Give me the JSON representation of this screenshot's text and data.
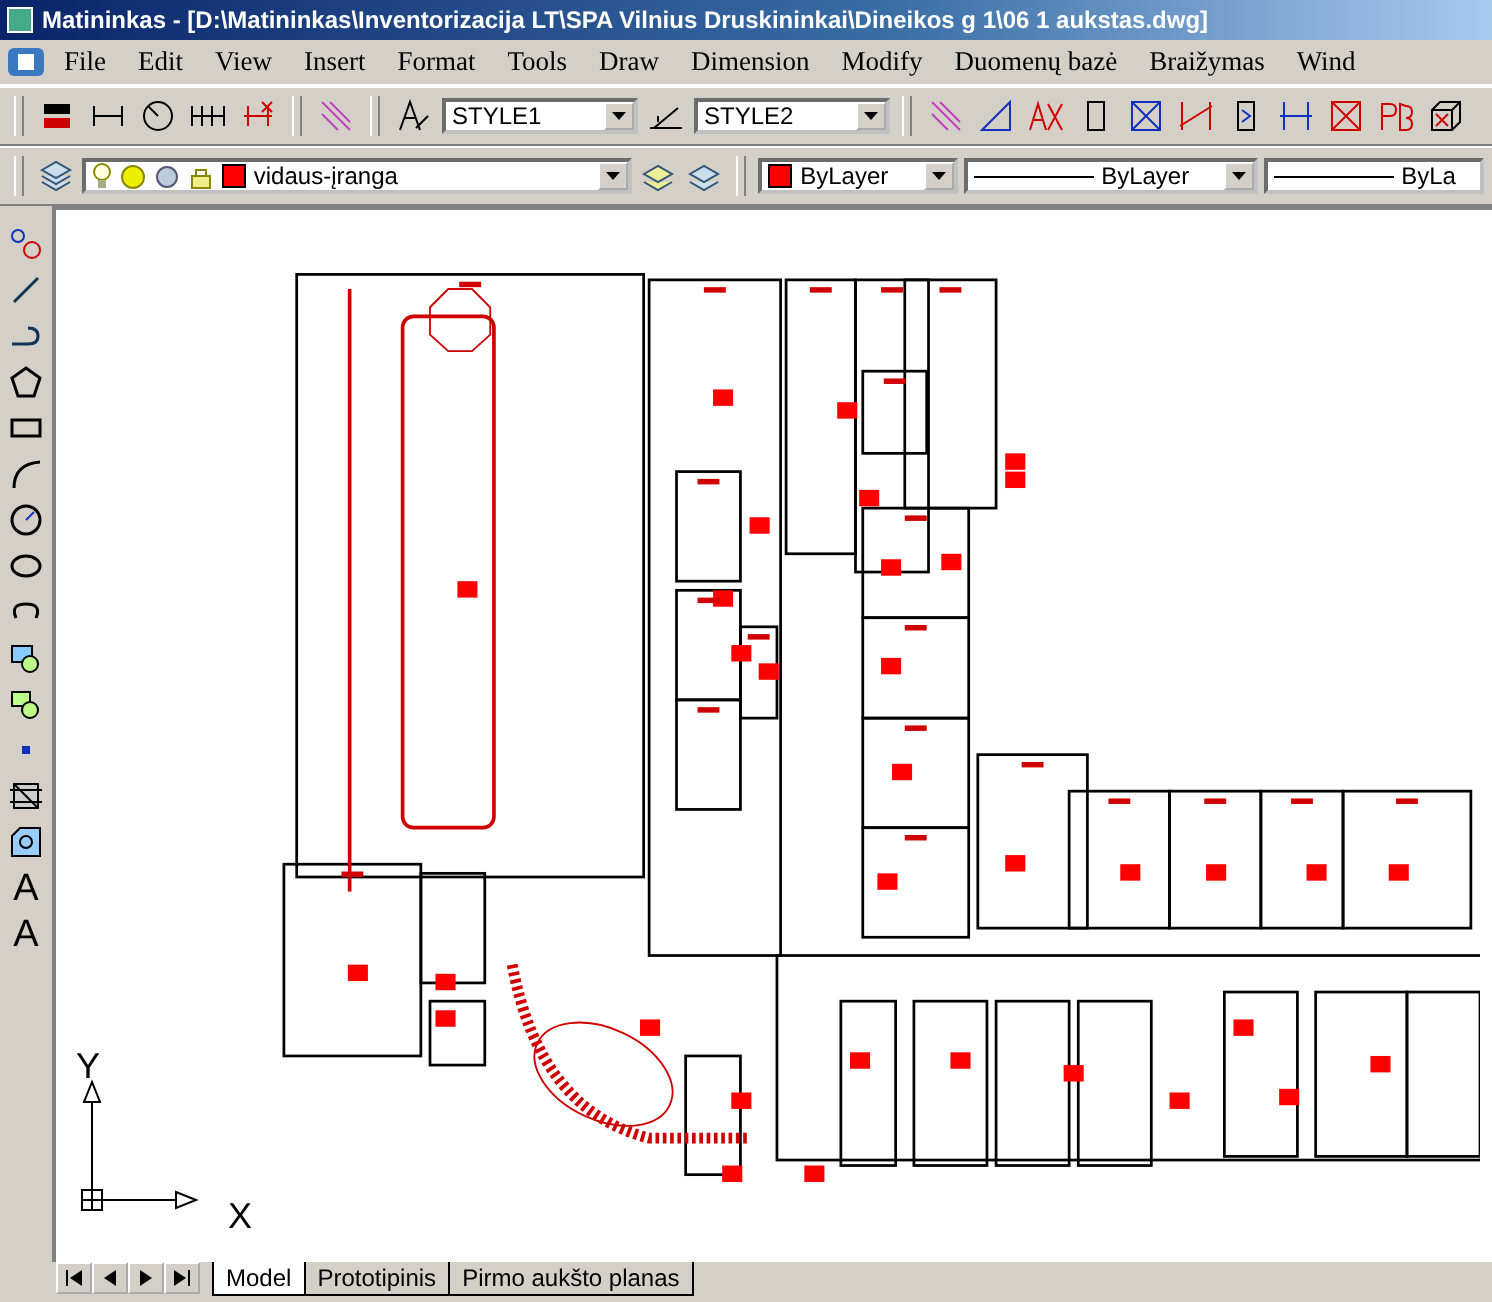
{
  "window": {
    "title": "Matininkas - [D:\\Matininkas\\Inventorizacija LT\\SPA Vilnius Druskininkai\\Dineikos g 1\\06 1 aukstas.dwg]"
  },
  "menu": [
    "File",
    "Edit",
    "View",
    "Insert",
    "Format",
    "Tools",
    "Draw",
    "Dimension",
    "Modify",
    "Duomenų bazė",
    "Braižymas",
    "Wind"
  ],
  "styles_toolbar": {
    "text_style": "STYLE1",
    "dimension_style": "STYLE2"
  },
  "layers_toolbar": {
    "layer": "vidaus-įranga",
    "color_mode": "ByLayer",
    "linetype": "ByLayer",
    "lineweight": "ByLa"
  },
  "text_tools": [
    "A",
    "A"
  ],
  "ucs": {
    "y_label": "Y",
    "x_label": "X"
  },
  "layout_tabs": [
    {
      "label": "Model",
      "selected": true
    },
    {
      "label": "Prototipinis",
      "selected": false
    },
    {
      "label": "Pirmo aukšto planas",
      "selected": false
    }
  ]
}
